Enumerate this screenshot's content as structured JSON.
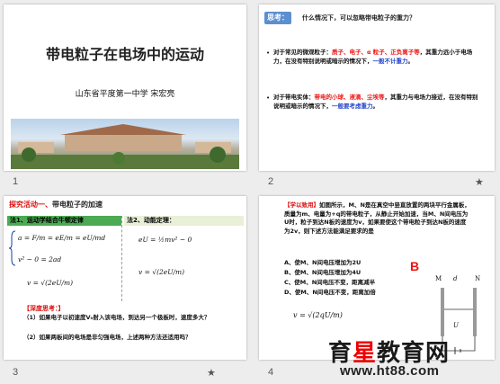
{
  "slides": [
    {
      "number": "1",
      "title": "带电粒子在电场中的运动",
      "subtitle": "山东省平度第一中学   宋宏亮"
    },
    {
      "number": "2",
      "badge": "思考：",
      "question": "什么情况下，可以忽略带电粒子的重力？",
      "p1_pre": "对于常见的微观粒子：",
      "p1_red": "质子、电子、α 粒子、正负离子等",
      "p1_post": "，其重力远小于电场力，在没有特别说明或暗示的情况下，",
      "p1_blue": "一般不计重力",
      "p1_end": "。",
      "p2_pre": "对于带电实体：",
      "p2_red": "带电的小球、液滴、尘埃等",
      "p2_post": "，其重力与电场力接近，在没有特别说明或暗示的情况下，",
      "p2_blue": "一般要考虑重力",
      "p2_end": "。"
    },
    {
      "number": "3",
      "title_red": "探究活动一、",
      "title_dark": "带电粒子的加速",
      "method1": "法1、运动学结合牛顿定律",
      "method2": "法2、动能定理：",
      "eq1": "a = F/m = eE/m = eU/md",
      "eq2": "v² − 0 = 2ad",
      "eq3": "v = √(2eU/m)",
      "eq4": "eU = ½mv² − 0",
      "eq5": "v = √(2eU/m)",
      "think_head": "【深度思考：】",
      "think1": "（1）如果电子以初速度V₀射入该电场，到达另一个极板时，速度多大？",
      "think2": "（2）如果两板间的电场是非匀强电场，上述两种方法还适用吗？"
    },
    {
      "number": "4",
      "tag": "【学以致用】",
      "body": "如图所示，M、N是在真空中竖直放置的两块平行金属板，质量为m、电量为+q的带电粒子，从静止开始加速，当M、N间电压为U时，粒子到达N板的速度为v，如果要使这个带电粒子到达N板的速度为2v，则下述方法能满足要求的是",
      "opts": [
        "A、使M、N间电压增加为2U",
        "B、使M、N间电压增加为4U",
        "C、使M、N间电压不变，距离减半",
        "D、使M、N间电压不变，距离加倍"
      ],
      "answer": "B",
      "formula": "v = √(2qU/m)",
      "label_M": "M",
      "label_N": "N",
      "label_d": "d",
      "label_U": "U"
    }
  ],
  "watermark": {
    "line1_a": "育",
    "line1_b": "星",
    "line1_c": "教育网",
    "line2": "www.ht88.com"
  }
}
